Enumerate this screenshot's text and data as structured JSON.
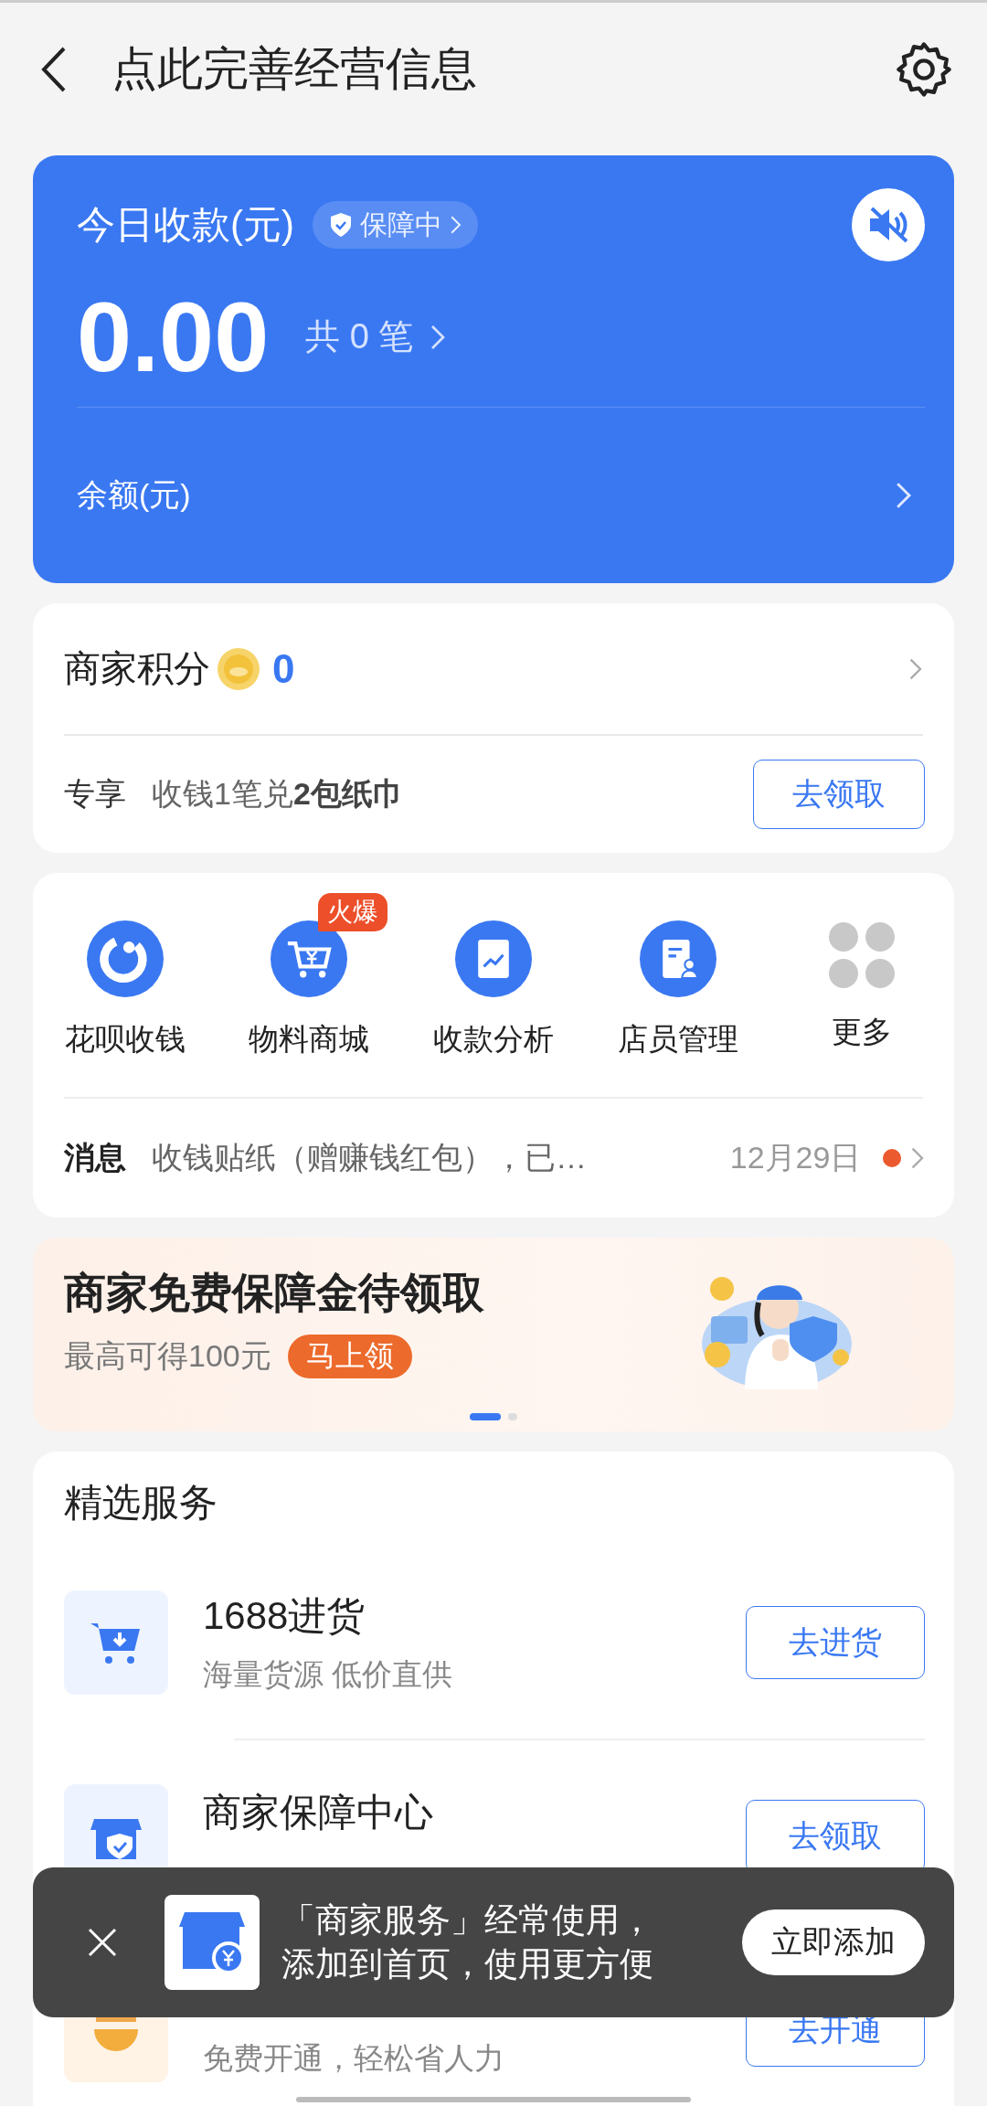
{
  "header": {
    "title": "点此完善经营信息"
  },
  "income": {
    "title": "今日收款(元)",
    "badge": "保障中",
    "amount": "0.00",
    "count": "共 0 笔",
    "balance_label": "余额(元)",
    "sound_muted": true
  },
  "points": {
    "label": "商家积分",
    "value": "0",
    "promo_tag": "专享",
    "promo_text": "收钱1笔兑**2包纸巾**",
    "promo_button": "去领取"
  },
  "shortcuts": [
    {
      "kind": "app",
      "label": "花呗收钱"
    },
    {
      "kind": "app",
      "label": "物料商城",
      "badge": "火爆"
    },
    {
      "kind": "app",
      "label": "收款分析"
    },
    {
      "kind": "app",
      "label": "店员管理"
    },
    {
      "kind": "more",
      "label": "更多"
    }
  ],
  "message": {
    "label": "消息",
    "text": "收钱贴纸（赠赚钱红包），已…",
    "date": "12月29日",
    "unread": true
  },
  "banner": {
    "title": "商家免费保障金待领取",
    "subtitle": "最高可得100元",
    "button": "马上领",
    "pages": [
      {
        "selected": true
      },
      {
        "selected": false
      }
    ]
  },
  "services": {
    "title": "精选服务",
    "items": [
      {
        "title": "1688进货",
        "subtitle": "海量货源 低价直供",
        "button": "去进货"
      },
      {
        "title": "商家保障中心",
        "button": "去领取"
      },
      {
        "subtitle": "免费开通，轻松省人力",
        "button": "去开通"
      }
    ]
  },
  "toast": {
    "lines": [
      "「商家服务」经常使用，",
      "添加到首页，使用更方便"
    ],
    "button": "立即添加"
  }
}
